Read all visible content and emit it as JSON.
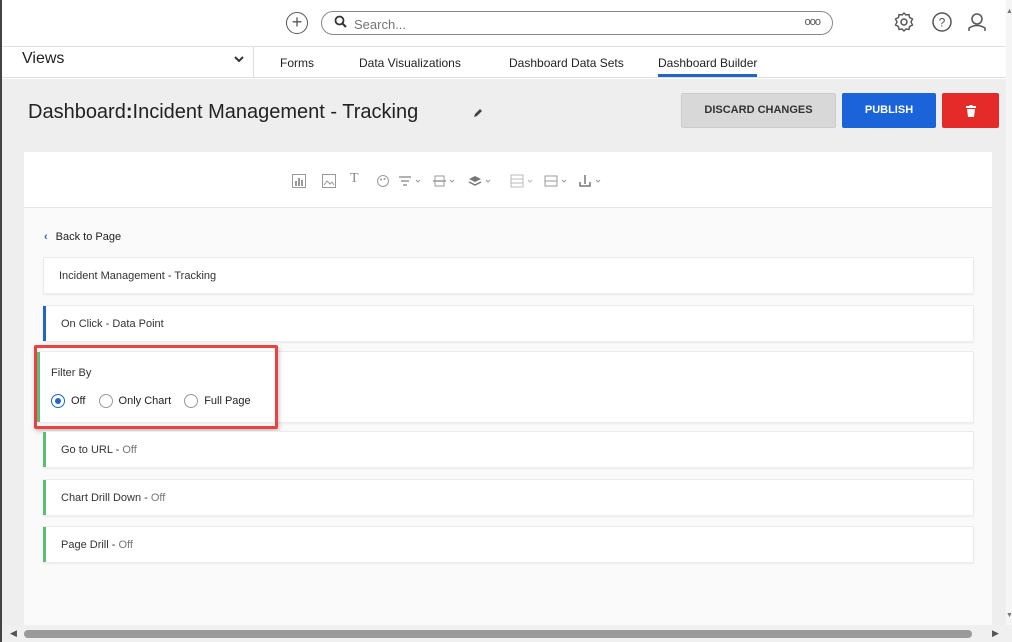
{
  "topbar": {
    "add_icon": "plus-circle-icon",
    "search_placeholder": "Search...",
    "search_more": "ooo",
    "settings_icon": "gear-icon",
    "help_icon": "help-icon",
    "profile_icon": "user-icon"
  },
  "nav": {
    "views_label": "Views",
    "tabs": [
      "Forms",
      "Data Visualizations",
      "Dashboard Data Sets",
      "Dashboard Builder"
    ],
    "active_tab": "Dashboard Builder"
  },
  "header": {
    "title_prefix": "Dashboard",
    "title_sep": ":",
    "title_name": "Incident Management - Tracking",
    "discard_label": "DISCARD CHANGES",
    "publish_label": "PUBLISH",
    "delete_icon": "trash-icon"
  },
  "toolbar": {
    "icons": [
      "bar-chart-icon",
      "image-icon",
      "text-icon",
      "palette-icon",
      "align-icon",
      "valign-icon",
      "layers-icon",
      "grid-icon",
      "layout-icon",
      "download-icon"
    ]
  },
  "content": {
    "back_label": "Back to Page",
    "page_name": "Incident Management - Tracking",
    "on_click_label": "On Click",
    "on_click_value": "Data Point",
    "filter_by_label": "Filter By",
    "filter_options": [
      "Off",
      "Only Chart",
      "Full Page"
    ],
    "filter_selected": "Off",
    "go_to_url_label": "Go to URL",
    "go_to_url_value": "Off",
    "chart_drill_label": "Chart Drill Down",
    "chart_drill_value": "Off",
    "page_drill_label": "Page Drill",
    "page_drill_value": "Off"
  },
  "colors": {
    "accent_blue": "#1f66c8",
    "accent_green": "#5bbf73",
    "highlight_red": "#e84242",
    "publish_blue": "#1a63d8",
    "delete_red": "#e52a2a"
  }
}
